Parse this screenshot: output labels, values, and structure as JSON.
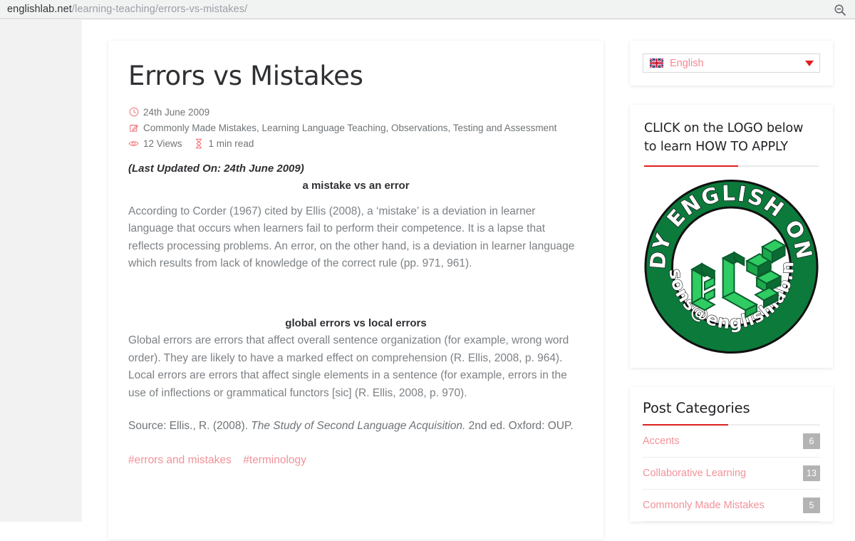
{
  "browser": {
    "url_host": "englishlab.net",
    "url_path": "/learning-teaching/errors-vs-mistakes/",
    "search_icon": "zoom-out-magnifier-icon"
  },
  "article": {
    "title": "Errors vs Mistakes",
    "date_icon": "clock-icon",
    "date": "24th June 2009",
    "categories_icon": "edit-square-icon",
    "categories": "Commonly Made Mistakes, Learning Language Teaching, Observations, Testing and Assessment",
    "views_icon": "eye-icon",
    "views": "12 Views",
    "readtime_icon": "hourglass-icon",
    "readtime": "1 min read",
    "last_updated": "(Last Updated On: 24th June 2009)",
    "heading_1": "a mistake vs an error",
    "paragraph_1": "According to Corder (1967) cited by Ellis (2008), a ‘mistake’ is a deviation in learner language that occurs when learners fail to perform their competence. It is a lapse that reflects processing problems. An error, on the other hand, is a deviation in learner language which results from lack of knowledge of the correct rule (pp. 971, 961).",
    "heading_2": "global errors vs local errors",
    "paragraph_2": "Global errors are errors that affect overall sentence organization (for example, wrong word order). They are likely to have a marked effect on comprehension (R. Ellis, 2008, p. 964). Local errors are errors that affect single elements in a sentence (for example, errors in the use of inflections or grammatical functors [sic] (R. Ellis, 2008, p. 970).",
    "source_prefix": "Source:  Ellis., R.  (2008). ",
    "source_italic": "The Study of Second Language Acquisition.",
    "source_suffix": " 2nd ed. Oxford: OUP.",
    "tags": [
      {
        "label": "#errors and mistakes"
      },
      {
        "label": "#terminology"
      }
    ]
  },
  "sidebar": {
    "language": {
      "flag_icon": "uk-flag-icon",
      "label": "English",
      "caret_icon": "chevron-down-icon"
    },
    "apply": {
      "line_1": "CLICK on the LOGO below",
      "line_2": "to learn HOW TO APPLY",
      "logo": {
        "name": "study-english-online-logo",
        "top_arc_text": "STUDY ENGLISH ONLINE",
        "bottom_arc_text": "lessons@englishlab.net",
        "center_text": "EL .NET",
        "ring_color": "#0b7a3b",
        "letter_color": "#33cc66"
      }
    },
    "categories": {
      "title": "Post Categories",
      "items": [
        {
          "label": "Accents",
          "count": "6"
        },
        {
          "label": "Collaborative Learning",
          "count": "13"
        },
        {
          "label": "Commonly Made Mistakes",
          "count": "5"
        }
      ]
    }
  },
  "colors": {
    "accent_red": "#e02020",
    "accent_pink": "#f2929a",
    "body_text": "#7d8185",
    "heading": "#2e3033",
    "badge_gray": "#b3b3b3"
  }
}
